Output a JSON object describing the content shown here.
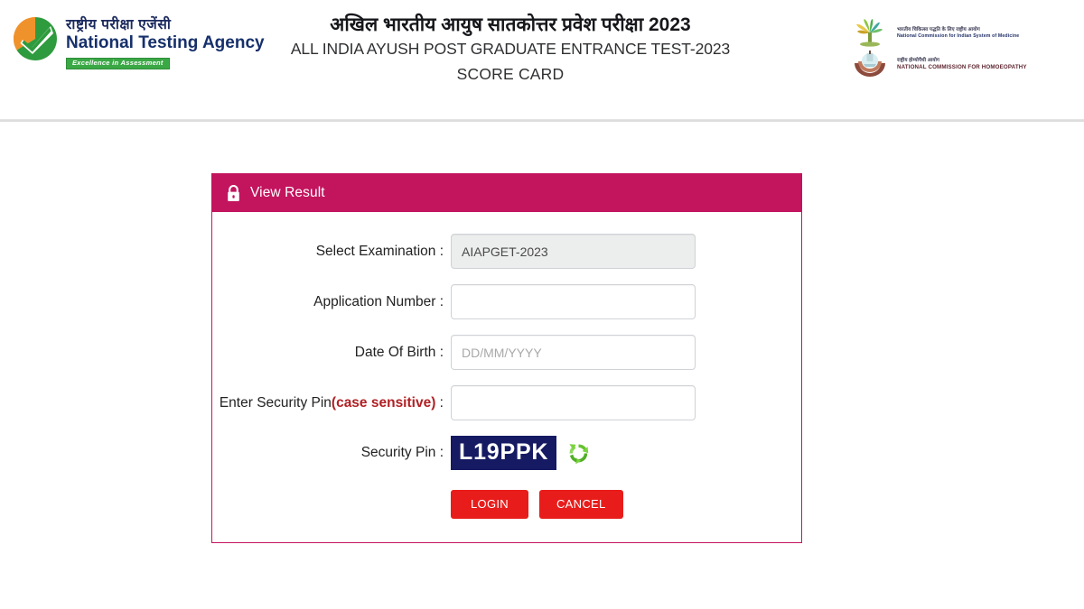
{
  "header": {
    "nta_logo": {
      "icon": "nta-circular-logo",
      "hindi_name": "राष्ट्रीय  परीक्षा  एजेंसी",
      "english_name": "National Testing Agency",
      "tagline": "Excellence in Assessment"
    },
    "titles": {
      "hindi": "अखिल भारतीय आयुष सातकोत्तर प्रवेश परीक्षा 2023",
      "english_line1": "ALL INDIA AYUSH POST GRADUATE ENTRANCE TEST-2023",
      "english_line2": "SCORE CARD"
    },
    "commission_logos": [
      {
        "icon": "ncism-emblem",
        "hindi": "भारतीय चिकित्सा पद्धति के लिए राष्ट्रीय आयोग",
        "english": "National Commission for Indian System of Medicine"
      },
      {
        "icon": "nch-emblem",
        "hindi": "राष्ट्रीय होम्योपैथी आयोग",
        "english": "NATIONAL COMMISSION FOR HOMOEOPATHY"
      }
    ]
  },
  "panel": {
    "icon": "lock-icon",
    "title": "View Result",
    "fields": [
      {
        "label": "Select Examination :",
        "value": "AIAPGET-2023",
        "placeholder": "",
        "disabled": true
      },
      {
        "label": "Application Number :",
        "value": "",
        "placeholder": "",
        "disabled": false
      },
      {
        "label": "Date Of Birth :",
        "value": "",
        "placeholder": "DD/MM/YYYY",
        "disabled": false
      }
    ],
    "security_pin_label_main": "Enter Security Pin",
    "security_pin_label_note": "(case sensitive)",
    "security_pin_label_colon": " :",
    "security_pin_value": "",
    "captcha_label": "Security Pin :",
    "captcha_text": "L19PPK",
    "refresh_icon": "refresh-icon",
    "buttons": {
      "login": "LOGIN",
      "cancel": "CANCEL"
    }
  },
  "colors": {
    "panel_accent": "#C3145E",
    "button_red": "#E81D1B",
    "captcha_background": "#151A62",
    "case_sensitive_red": "#B02024",
    "refresh_green": "#5FBF34",
    "nta_saffron": "#F0922B",
    "nta_green": "#2E9B3E",
    "nta_navy": "#16306B"
  }
}
